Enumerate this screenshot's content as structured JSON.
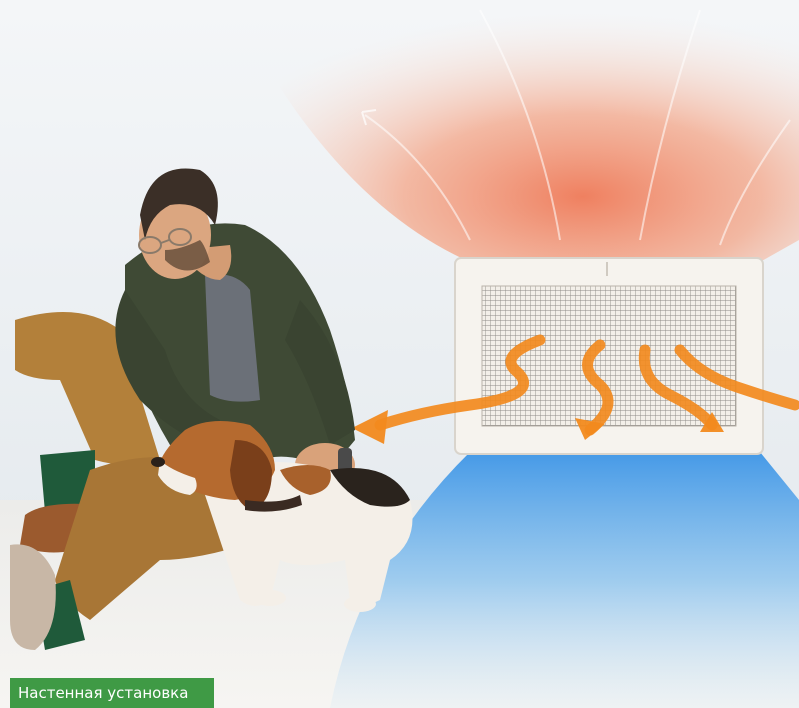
{
  "caption": "Настенная установка",
  "colors": {
    "warm_air": "#f08a6a",
    "cool_air": "#5aa7e8",
    "arrow": "#f28a1e",
    "caption_bg": "#3f9a45",
    "wall": "#eef2f5",
    "carpet": "#f2f2f0"
  }
}
